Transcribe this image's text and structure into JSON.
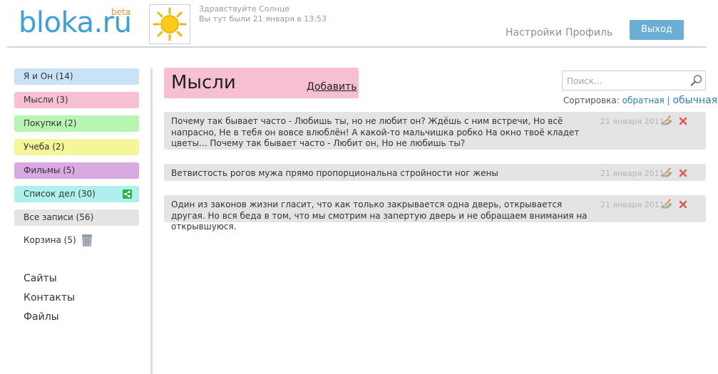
{
  "header": {
    "logo_text": "bloka.ru",
    "logo_badge": "beta",
    "greeting": "Здравствуйте Солнце",
    "last_visit": "Вы тут были 21 января в 13:53",
    "settings_label": "Настройки",
    "profile_label": "Профиль",
    "exit_label": "Выход"
  },
  "sidebar": {
    "categories": [
      {
        "label": "Я и Он (14)",
        "color": "#c9e2f8"
      },
      {
        "label": "Мысли (3)",
        "color": "#f7bfd3"
      },
      {
        "label": "Покупки (2)",
        "color": "#b8f5b2"
      },
      {
        "label": "Учеба (2)",
        "color": "#f5f59a"
      },
      {
        "label": "Фильмы (5)",
        "color": "#d9a9e2"
      },
      {
        "label": "Список дел (30)",
        "color": "#aef0ec"
      },
      {
        "label": "Все записи (56)",
        "color": "#e4e4e4"
      }
    ],
    "trash_label": "Корзина (5)",
    "links": [
      "Сайты",
      "Контакты",
      "Файлы"
    ]
  },
  "main": {
    "title": "Мысли",
    "add_label": "Добавить",
    "search_placeholder": "Поиск...",
    "sort_label": "Сортировка:",
    "sort_reverse": "обратная",
    "sort_separator": "|",
    "sort_normal": "обычная",
    "notes": [
      {
        "text": "Почему так бывает часто - Любишь ты, но не любит он? Ждёшь с ним встречи, Но всё напрасно, Не в тебя он вовсе влюблён! А какой-то мальчишка робко На окно твоё кладет цветы... Почему так бывает часто - Любит он, Но не любишь ты?",
        "date": "21 января 2011"
      },
      {
        "text": "Ветвистость рогов мужа прямо пропорциональна стройности ног жены",
        "date": "21 января 2011"
      },
      {
        "text": "Один из законов жизни гласит, что как только закрывается одна дверь, открывается другая. Но вся беда в том, что мы смотрим на запертую дверь и не обращаем внимания на открывшуюся.",
        "date": "21 января 2011"
      }
    ]
  },
  "colors": {
    "accent": "#3aa0d8",
    "exit_button": "#6aaed6",
    "note_bg": "#e4e4e4",
    "delete": "#e05a4e"
  },
  "icons": {
    "sun": "sun-icon",
    "share": "share-icon",
    "trash": "trash-icon",
    "search": "search-icon",
    "edit": "edit-icon",
    "delete": "delete-icon"
  }
}
